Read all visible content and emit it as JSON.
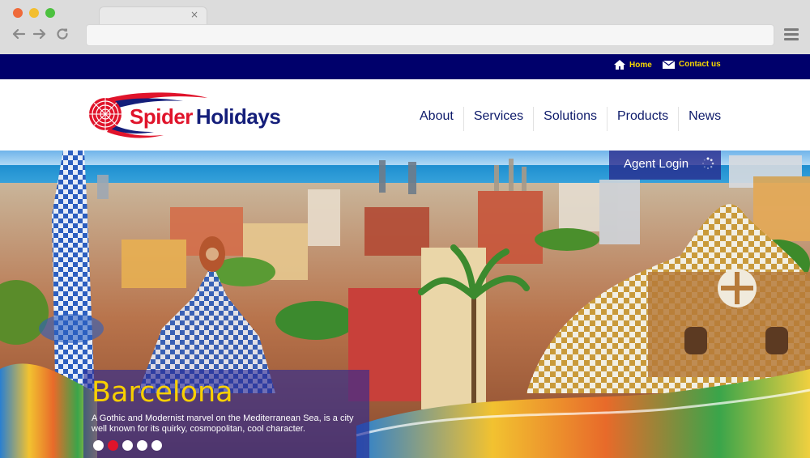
{
  "browser": {
    "tab_close": "×"
  },
  "topbar": {
    "home_label": "Home",
    "contact_label": "Contact us"
  },
  "header": {
    "logo_word1": "Spider",
    "logo_word2": "Holidays",
    "nav": [
      "About",
      "Services",
      "Solutions",
      "Products",
      "News"
    ]
  },
  "hero": {
    "agent_login": "Agent Login",
    "title": "Barcelona",
    "description": "A Gothic and Modernist marvel on the Mediterranean Sea, is a city well known for its quirky, cosmopolitan, cool character.",
    "slide_count": 5,
    "active_slide": 2
  },
  "colors": {
    "topbar": "#00006b",
    "accent_yellow": "#f8d800",
    "brand_red": "#e0142b",
    "brand_blue": "#141e7a"
  }
}
